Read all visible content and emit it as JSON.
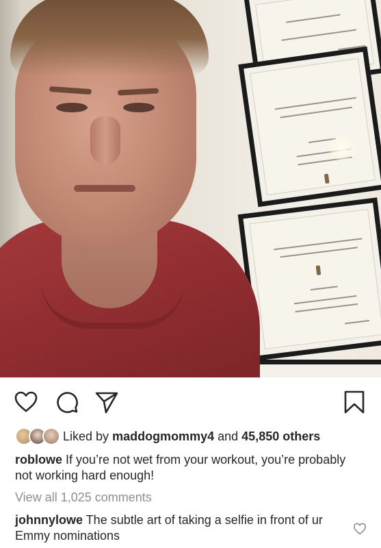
{
  "post": {
    "likes": {
      "prefix": "Liked by",
      "liker": "maddogmommy4",
      "connector": "and",
      "count_text": "45,850 others"
    },
    "caption": {
      "username": "roblowe",
      "text": "If you’re not wet from your workout, you’re probably not working hard enough!"
    },
    "view_comments_label": "View all 1,025 comments",
    "top_comment": {
      "username": "johnnylowe",
      "text": "The subtle art of taking a selfie in front of ur Emmy nominations"
    }
  },
  "icons": {
    "like": "heart-icon",
    "comment": "comment-bubble-icon",
    "share": "paper-plane-icon",
    "save": "bookmark-icon",
    "comment_like": "small-heart-icon"
  },
  "colors": {
    "text": "#262626",
    "muted": "#8e8e8e",
    "background": "#ffffff"
  }
}
